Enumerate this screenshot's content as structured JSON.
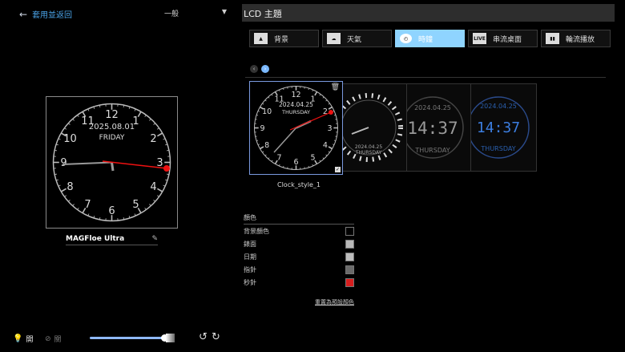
{
  "header": {
    "back_label": "套用並返回",
    "mode_label": "一般"
  },
  "left_clock": {
    "date": "2025.08.01",
    "weekday": "FRIDAY"
  },
  "device": {
    "name": "MAGFloe Ultra"
  },
  "bottom": {
    "light_label": "開",
    "off_label": "關"
  },
  "panel": {
    "title": "LCD 主題"
  },
  "tabs": [
    {
      "label": "背景",
      "icon": "image-icon"
    },
    {
      "label": "天氣",
      "icon": "weather-icon"
    },
    {
      "label": "時鐘",
      "icon": "clock-icon",
      "active": true
    },
    {
      "label": "串流桌面",
      "icon_text": "LIVE"
    },
    {
      "label": "輪流播放",
      "icon": "slideshow-icon"
    }
  ],
  "style_card": {
    "label": "Clock_style_1",
    "date": "2024.04.25",
    "weekday": "THURSDAY"
  },
  "ghosts": [
    {
      "date": "2024.04.25",
      "weekday": "THURSDAY"
    },
    {
      "date": "2024.04.25",
      "time": "14:37",
      "weekday": "THURSDAY"
    },
    {
      "date": "2024.04.25",
      "time": "14:37",
      "weekday": "THURSDAY"
    }
  ],
  "colors": {
    "title": "顏色",
    "items": [
      {
        "label": "背景顏色",
        "color": "#000000"
      },
      {
        "label": "錶面",
        "color": "#b8b8b8"
      },
      {
        "label": "日期",
        "color": "#bdbdbd"
      },
      {
        "label": "指針",
        "color": "#6a6a6a"
      },
      {
        "label": "秒針",
        "color": "#d71e1e"
      }
    ],
    "reset_label": "重置為預設顏色"
  }
}
